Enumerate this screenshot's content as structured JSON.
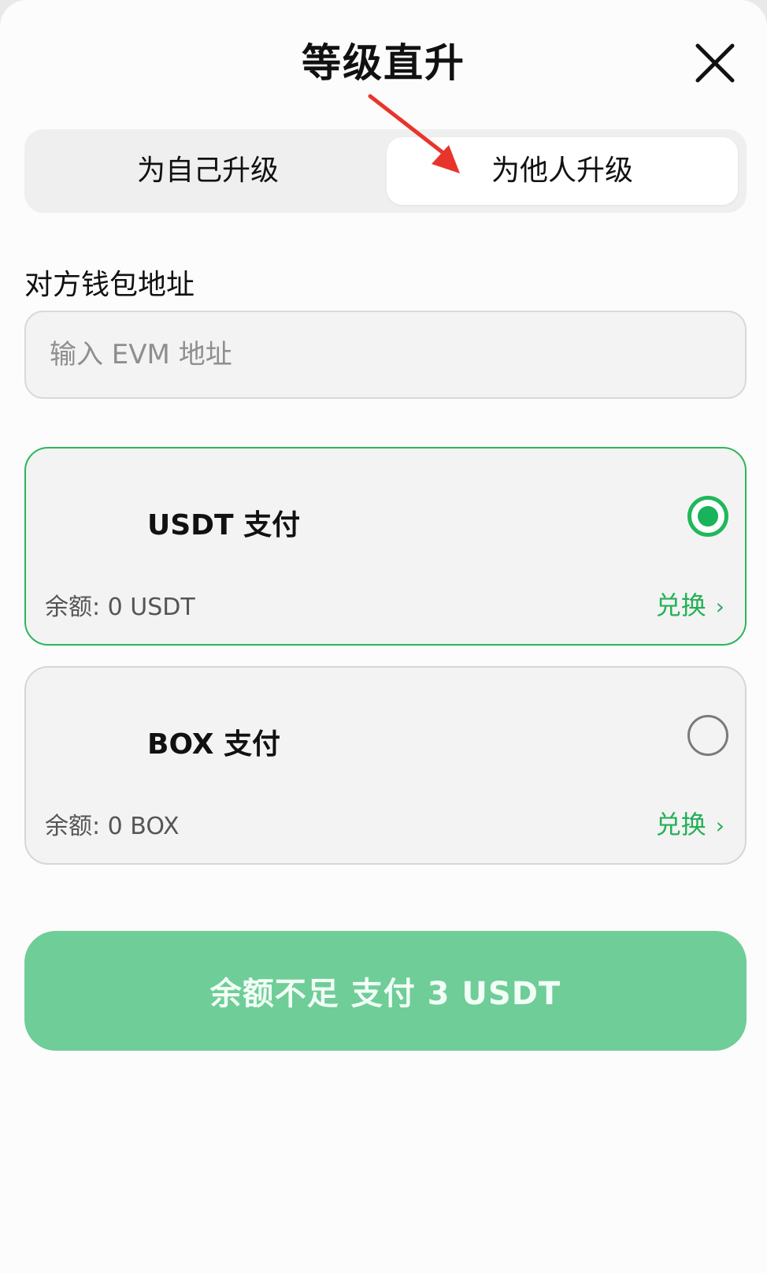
{
  "header": {
    "title": "等级直升",
    "close_icon": "close-icon"
  },
  "segment": {
    "tabs": [
      {
        "label": "为自己升级",
        "selected": false
      },
      {
        "label": "为他人升级",
        "selected": true
      }
    ]
  },
  "annotation": {
    "arrow_color": "#e8352b"
  },
  "address": {
    "label": "对方钱包地址",
    "placeholder": "输入 EVM 地址",
    "value": ""
  },
  "payment_options": [
    {
      "name": "USDT 支付",
      "balance": "余额: 0 USDT",
      "exchange_label": "兑换",
      "selected": true
    },
    {
      "name": "BOX 支付",
      "balance": "余额: 0 BOX",
      "exchange_label": "兑换",
      "selected": false
    }
  ],
  "pay_button": {
    "label": "余额不足 支付 3 USDT"
  },
  "colors": {
    "accent_green": "#1fb85a",
    "button_green": "#6fcd98",
    "background": "#fcfcfc"
  }
}
